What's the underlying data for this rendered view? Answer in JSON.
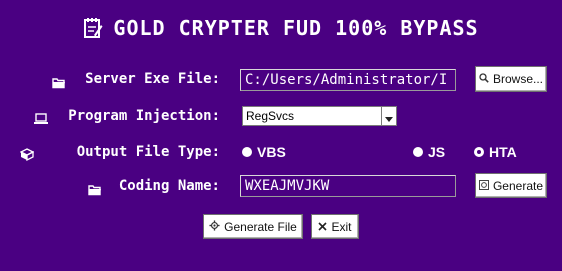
{
  "title": "GOLD CRYPTER FUD 100% BYPASS",
  "server_exe": {
    "label": "Server Exe File:",
    "value": "C:/Users/Administrator/I",
    "button": "Browse..."
  },
  "program_injection": {
    "label": "Program Injection:",
    "selected": "RegSvcs"
  },
  "output_type": {
    "label": "Output File Type:",
    "options": [
      {
        "label": "VBS",
        "checked": false
      },
      {
        "label": "JS",
        "checked": false
      },
      {
        "label": "HTA",
        "checked": true
      }
    ]
  },
  "coding_name": {
    "label": "Coding Name:",
    "value": "WXEAJMVJKW",
    "button": "Generate"
  },
  "actions": {
    "generate_file": "Generate File",
    "exit": "Exit"
  },
  "colors": {
    "background": "#4a0082",
    "text": "#ffffff"
  }
}
